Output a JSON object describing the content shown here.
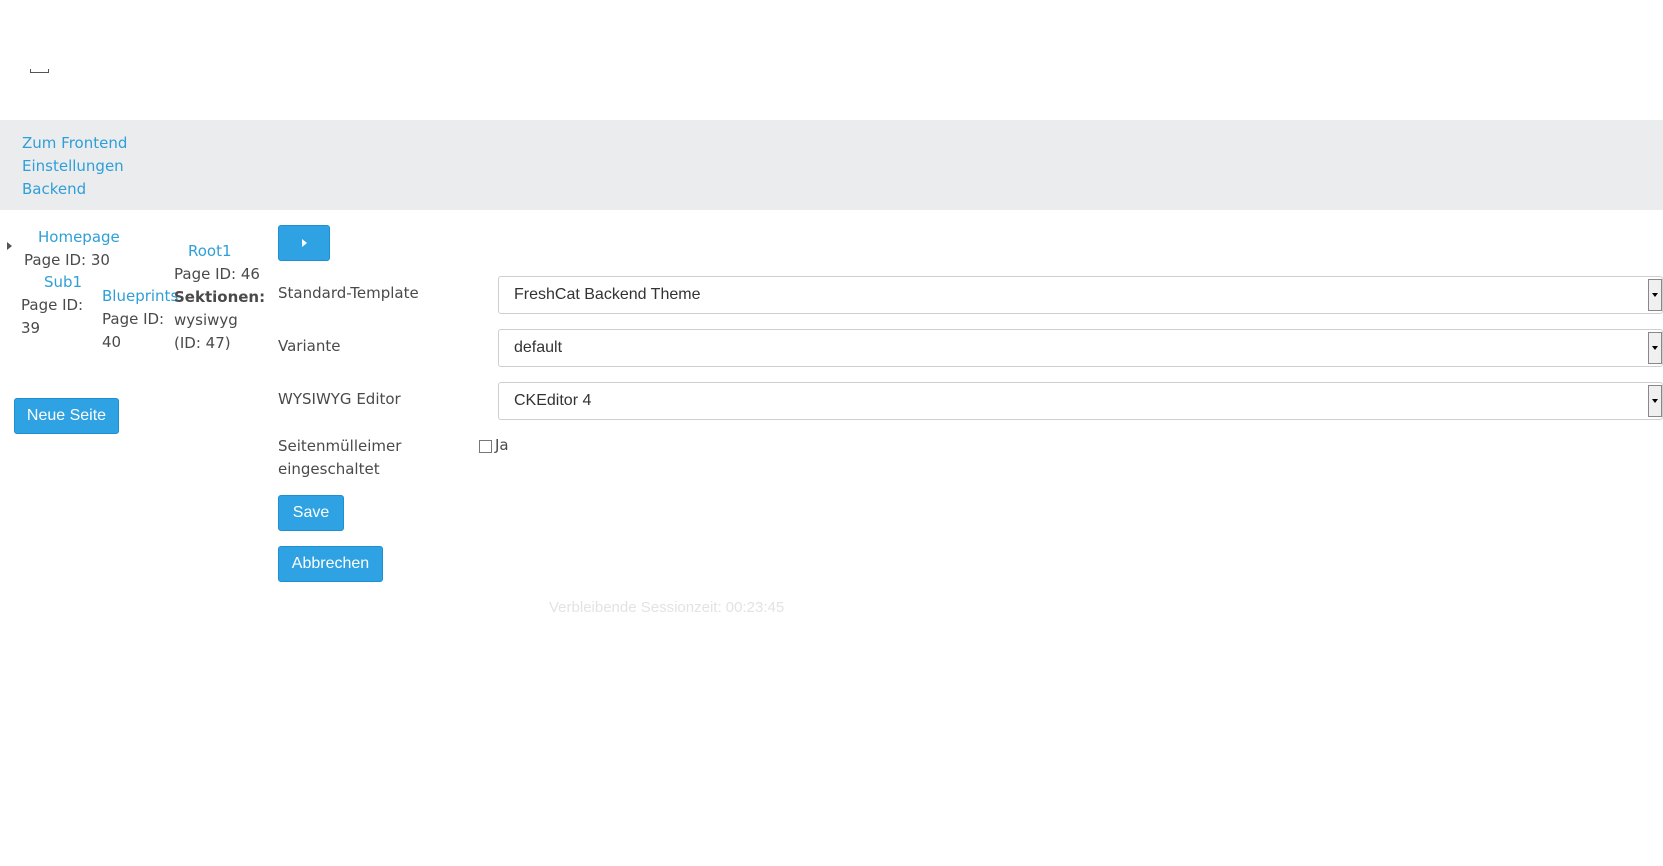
{
  "topnav": {
    "links": [
      "Zum Frontend",
      "Einstellungen",
      "Backend"
    ]
  },
  "tree": {
    "homepage": {
      "title": "Homepage",
      "page_id": "Page ID: 30"
    },
    "sub1": {
      "title": "Sub1",
      "page_id": "Page ID: 39"
    },
    "blueprints": {
      "title": "Blueprints",
      "page_id": "Page ID: 40"
    },
    "root1": {
      "title": "Root1",
      "page_id": "Page ID: 46",
      "sections_label": "Sektionen:",
      "sections_value": "wysiwyg (ID: 47)"
    }
  },
  "new_page_button": "Neue Seite",
  "form": {
    "template": {
      "label": "Standard-Template",
      "value": "FreshCat Backend Theme"
    },
    "variant": {
      "label": "Variante",
      "value": "default"
    },
    "wysiwyg": {
      "label": "WYSIWYG Editor",
      "value": "CKEditor 4"
    },
    "trash": {
      "label": "Seitenmülleimer eingeschaltet",
      "option": "Ja",
      "checked": false
    },
    "save": "Save",
    "cancel": "Abbrechen"
  },
  "session": "Verbleibende Sessionzeit: 00:23:45",
  "colors": {
    "accent": "#2ea2e3",
    "link": "#2e9fd8",
    "nav_bg": "#ebecee"
  }
}
